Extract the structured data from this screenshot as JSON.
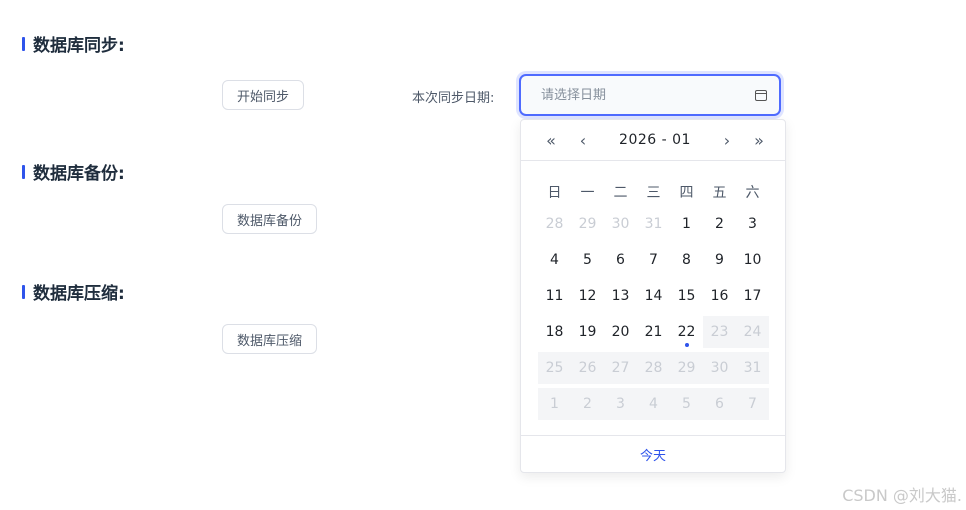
{
  "sections": {
    "sync": {
      "title": "数据库同步:",
      "button_label": "开始同步"
    },
    "backup": {
      "title": "数据库备份:",
      "button_label": "数据库备份"
    },
    "compress": {
      "title": "数据库压缩:",
      "button_label": "数据库压缩"
    }
  },
  "sync_date": {
    "label": "本次同步日期:",
    "placeholder": "请选择日期",
    "value": ""
  },
  "calendar": {
    "title": "2026 - 01",
    "nav": {
      "prev_year": "«",
      "prev_month": "‹",
      "next_month": "›",
      "next_year": "»"
    },
    "weekdays": [
      "日",
      "一",
      "二",
      "三",
      "四",
      "五",
      "六"
    ],
    "weeks": [
      [
        {
          "d": "28",
          "s": "muted"
        },
        {
          "d": "29",
          "s": "muted"
        },
        {
          "d": "30",
          "s": "muted"
        },
        {
          "d": "31",
          "s": "muted"
        },
        {
          "d": "1",
          "s": ""
        },
        {
          "d": "2",
          "s": ""
        },
        {
          "d": "3",
          "s": ""
        }
      ],
      [
        {
          "d": "4",
          "s": ""
        },
        {
          "d": "5",
          "s": ""
        },
        {
          "d": "6",
          "s": ""
        },
        {
          "d": "7",
          "s": ""
        },
        {
          "d": "8",
          "s": ""
        },
        {
          "d": "9",
          "s": ""
        },
        {
          "d": "10",
          "s": ""
        }
      ],
      [
        {
          "d": "11",
          "s": ""
        },
        {
          "d": "12",
          "s": ""
        },
        {
          "d": "13",
          "s": ""
        },
        {
          "d": "14",
          "s": ""
        },
        {
          "d": "15",
          "s": ""
        },
        {
          "d": "16",
          "s": ""
        },
        {
          "d": "17",
          "s": ""
        }
      ],
      [
        {
          "d": "18",
          "s": ""
        },
        {
          "d": "19",
          "s": ""
        },
        {
          "d": "20",
          "s": ""
        },
        {
          "d": "21",
          "s": ""
        },
        {
          "d": "22",
          "s": "today"
        },
        {
          "d": "23",
          "s": "disabled"
        },
        {
          "d": "24",
          "s": "disabled"
        }
      ],
      [
        {
          "d": "25",
          "s": "disabled"
        },
        {
          "d": "26",
          "s": "disabled"
        },
        {
          "d": "27",
          "s": "disabled"
        },
        {
          "d": "28",
          "s": "disabled"
        },
        {
          "d": "29",
          "s": "disabled"
        },
        {
          "d": "30",
          "s": "disabled"
        },
        {
          "d": "31",
          "s": "disabled"
        }
      ],
      [
        {
          "d": "1",
          "s": "disabled"
        },
        {
          "d": "2",
          "s": "disabled"
        },
        {
          "d": "3",
          "s": "disabled"
        },
        {
          "d": "4",
          "s": "disabled"
        },
        {
          "d": "5",
          "s": "disabled"
        },
        {
          "d": "6",
          "s": "disabled"
        },
        {
          "d": "7",
          "s": "disabled"
        }
      ]
    ],
    "today_label": "今天"
  },
  "watermark": "CSDN @刘大猫.",
  "colors": {
    "accent": "#2f54eb",
    "focus_border": "#4f6bff",
    "muted_text": "#c9cdd4",
    "disabled_bg": "#f4f5f7"
  },
  "icons": {
    "date_input": "calendar-icon"
  }
}
